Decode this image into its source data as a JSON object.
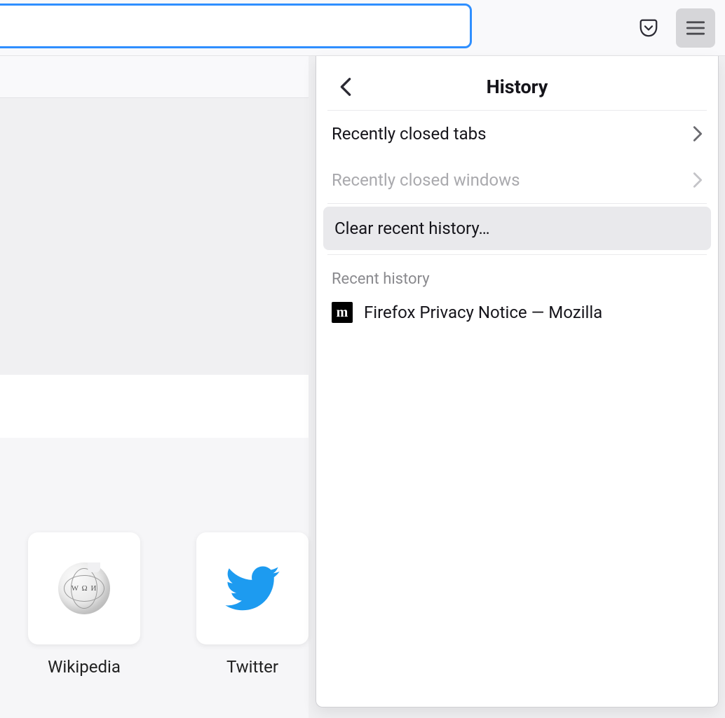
{
  "toolbar": {
    "url_value": "",
    "url_placeholder": ""
  },
  "panel": {
    "title": "History",
    "recently_closed_tabs": "Recently closed tabs",
    "recently_closed_windows": "Recently closed windows",
    "clear_recent_history": "Clear recent history…",
    "section_label": "Recent history",
    "items": [
      {
        "favicon_letter": "m",
        "title": "Firefox Privacy Notice — Mozilla"
      }
    ]
  },
  "top_sites": [
    {
      "id": "wikipedia",
      "label": "Wikipedia"
    },
    {
      "id": "twitter",
      "label": "Twitter"
    }
  ]
}
